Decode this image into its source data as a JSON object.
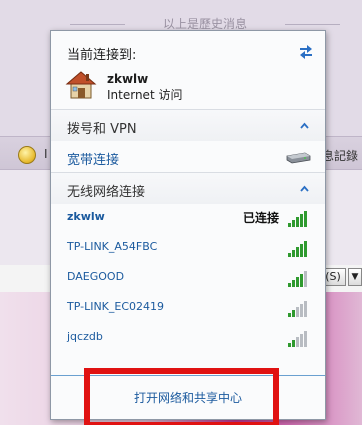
{
  "background": {
    "history_text": "以上是歷史消息",
    "toolbar_letter": "I",
    "record_text": "息記錄",
    "s_button": "(S)",
    "dropdown_arrow": "▼"
  },
  "panel": {
    "connected_title": "当前连接到:",
    "current_connection": {
      "name": "zkwlw",
      "access": "Internet 访问"
    },
    "dialup_section": {
      "label": "拨号和 VPN",
      "items": [
        {
          "label": "宽带连接",
          "icon": "modem-icon"
        }
      ]
    },
    "wireless_section": {
      "label": "无线网络连接",
      "networks": [
        {
          "name": "zkwlw",
          "status": "已连接",
          "bold": true,
          "signal_bars": 5
        },
        {
          "name": "TP-LINK_A54FBC",
          "status": "",
          "bold": false,
          "signal_bars": 5
        },
        {
          "name": "DAEGOOD",
          "status": "",
          "bold": false,
          "signal_bars": 4
        },
        {
          "name": "TP-LINK_EC02419",
          "status": "",
          "bold": false,
          "signal_bars": 2
        },
        {
          "name": "jqczdb",
          "status": "",
          "bold": false,
          "signal_bars": 2
        }
      ]
    },
    "open_center_link": "打开网络和共享中心"
  },
  "colors": {
    "link_blue": "#1b5a9e",
    "signal_green": "#2f9a2f",
    "signal_gray": "#b8bcc2",
    "highlight_red": "#e01212"
  }
}
